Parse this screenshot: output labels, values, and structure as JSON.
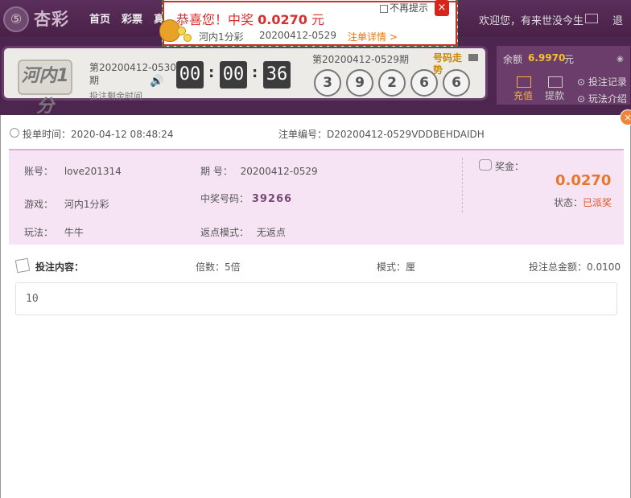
{
  "nav": {
    "logo_text": "杏彩",
    "links": [
      "首页",
      "彩票",
      "真"
    ],
    "welcome": "欢迎您，有来世没今生",
    "logout": "退"
  },
  "lottery": {
    "logo_text": "河内1分",
    "current_issue": "第20200412-0530期",
    "remain_label": "投注剩余时间",
    "countdown": [
      "00",
      "00",
      "36"
    ],
    "last_issue": "第20200412-0529期",
    "balls": [
      "3",
      "9",
      "2",
      "6",
      "6"
    ],
    "trend_label": "号码走势",
    "balance_label": "余额",
    "balance_value": "6.9970",
    "balance_unit": "元",
    "recharge": "充值",
    "withdraw": "提款",
    "bet_record": "投注记录",
    "play_intro": "玩法介绍"
  },
  "toast": {
    "title_prefix": "恭喜您！中奖",
    "amount": "0.0270",
    "unit": "元",
    "no_remind": "不再提示",
    "close": "×",
    "game": "河内1分彩",
    "issue": "20200412-0529",
    "detail_link": "注单详情 >"
  },
  "detail": {
    "close": "×",
    "bet_time": "投单时间：2020-04-12 08:48:24",
    "order_no": "注单编号：D20200412-0529VDDBEHDAIDH",
    "account_label": "账号：",
    "account": "love201314",
    "issue_label": "期 号：",
    "issue": "20200412-0529",
    "game_label": "游戏：",
    "game": "河内1分彩",
    "win_number_label": "中奖号码：",
    "win_number": "39266",
    "play_label": "玩法：",
    "play": "牛牛",
    "rebate_label": "返点模式：",
    "rebate": "无返点",
    "prize_label": "奖金：",
    "prize": "0.0270",
    "status_label": "状态：",
    "status": "已派奖",
    "bet_content_title": "投注内容：",
    "multiple": "倍数：5倍",
    "mode": "模式：厘",
    "total": "投注总金额：0.0100",
    "bet_content": "10"
  },
  "colors": {
    "nav_bg": "#4a2148",
    "accent_orange": "#e8772e",
    "toast_red": "#d43030",
    "info_bg": "#f6e4f4"
  }
}
